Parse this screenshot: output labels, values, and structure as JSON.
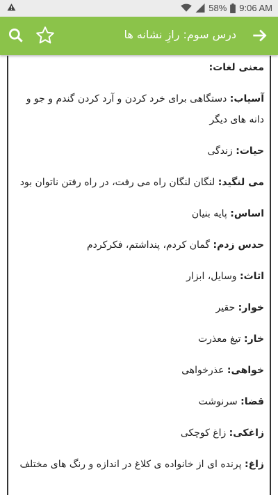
{
  "status": {
    "left_icon": "warning-icon",
    "battery": "58%",
    "time": "9:06 AM"
  },
  "appbar": {
    "title": "درس سوم: رازِ نشانه ها"
  },
  "content": {
    "heading": "معنی لغات:",
    "entries": [
      {
        "term": "آسیاب:",
        "def": " دستگاهی برای خرد کردن و آرد کردن گندم و جو و دانه های دیگر"
      },
      {
        "term": "حیات:",
        "def": " زندگی"
      },
      {
        "term": "می لنگید:",
        "def": " لنگان لنگان راه می رفت، در راه رفتن ناتوان بود"
      },
      {
        "term": "اساس:",
        "def": " پایه بنیان"
      },
      {
        "term": "حدس زدم:",
        "def": " گمان کردم، پنداشتم، فکرکردم"
      },
      {
        "term": "اثاث:",
        "def": " وسایل، ابزار"
      },
      {
        "term": "خوار:",
        "def": " حقیر"
      },
      {
        "term": "خار:",
        "def": " تیغ معذرت"
      },
      {
        "term": "خواهی:",
        "def": " عذرخواهی"
      },
      {
        "term": "قضا:",
        "def": " سرنوشت"
      },
      {
        "term": "زاغکی:",
        "def": " زاغ کوچکی"
      },
      {
        "term": "زاغ:",
        "def": " پرنده ای از خانواده ی کلاغ در اندازه و رنگ های مختلف"
      }
    ]
  }
}
